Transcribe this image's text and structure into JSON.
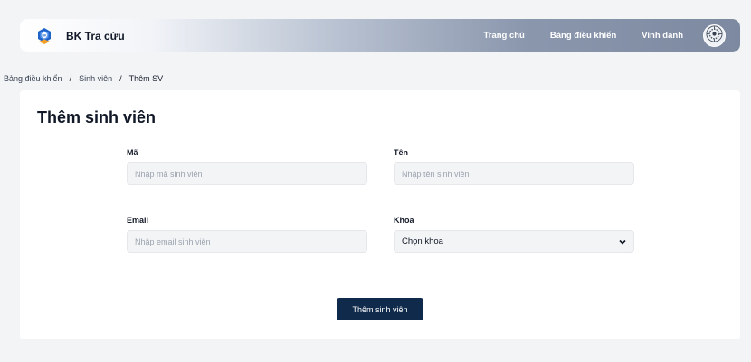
{
  "navbar": {
    "brand_name": "BK Tra cứu",
    "logo_icon": "bk-logo-icon",
    "links": [
      "Trang chủ",
      "Bảng điều khiển",
      "Vinh danh"
    ],
    "avatar_icon": "avatar-icon"
  },
  "breadcrumb": {
    "items": [
      "Bảng điều khiển",
      "Sinh viên",
      "Thêm SV"
    ],
    "separator": "/"
  },
  "form": {
    "title": "Thêm sinh viên",
    "fields": {
      "ma": {
        "label": "Mã",
        "placeholder": "Nhập mã sinh viên",
        "value": ""
      },
      "ten": {
        "label": "Tên",
        "placeholder": "Nhập tên sinh viên",
        "value": ""
      },
      "email": {
        "label": "Email",
        "placeholder": "Nhập email sinh viên",
        "value": ""
      },
      "khoa": {
        "label": "Khoa",
        "selected": "Chọn khoa"
      }
    },
    "submit_label": "Thêm sinh viên"
  },
  "colors": {
    "primary": "#102a4c",
    "background": "#f3f4f6",
    "logo_blue": "#1e63c9",
    "logo_orange": "#f4a023"
  }
}
